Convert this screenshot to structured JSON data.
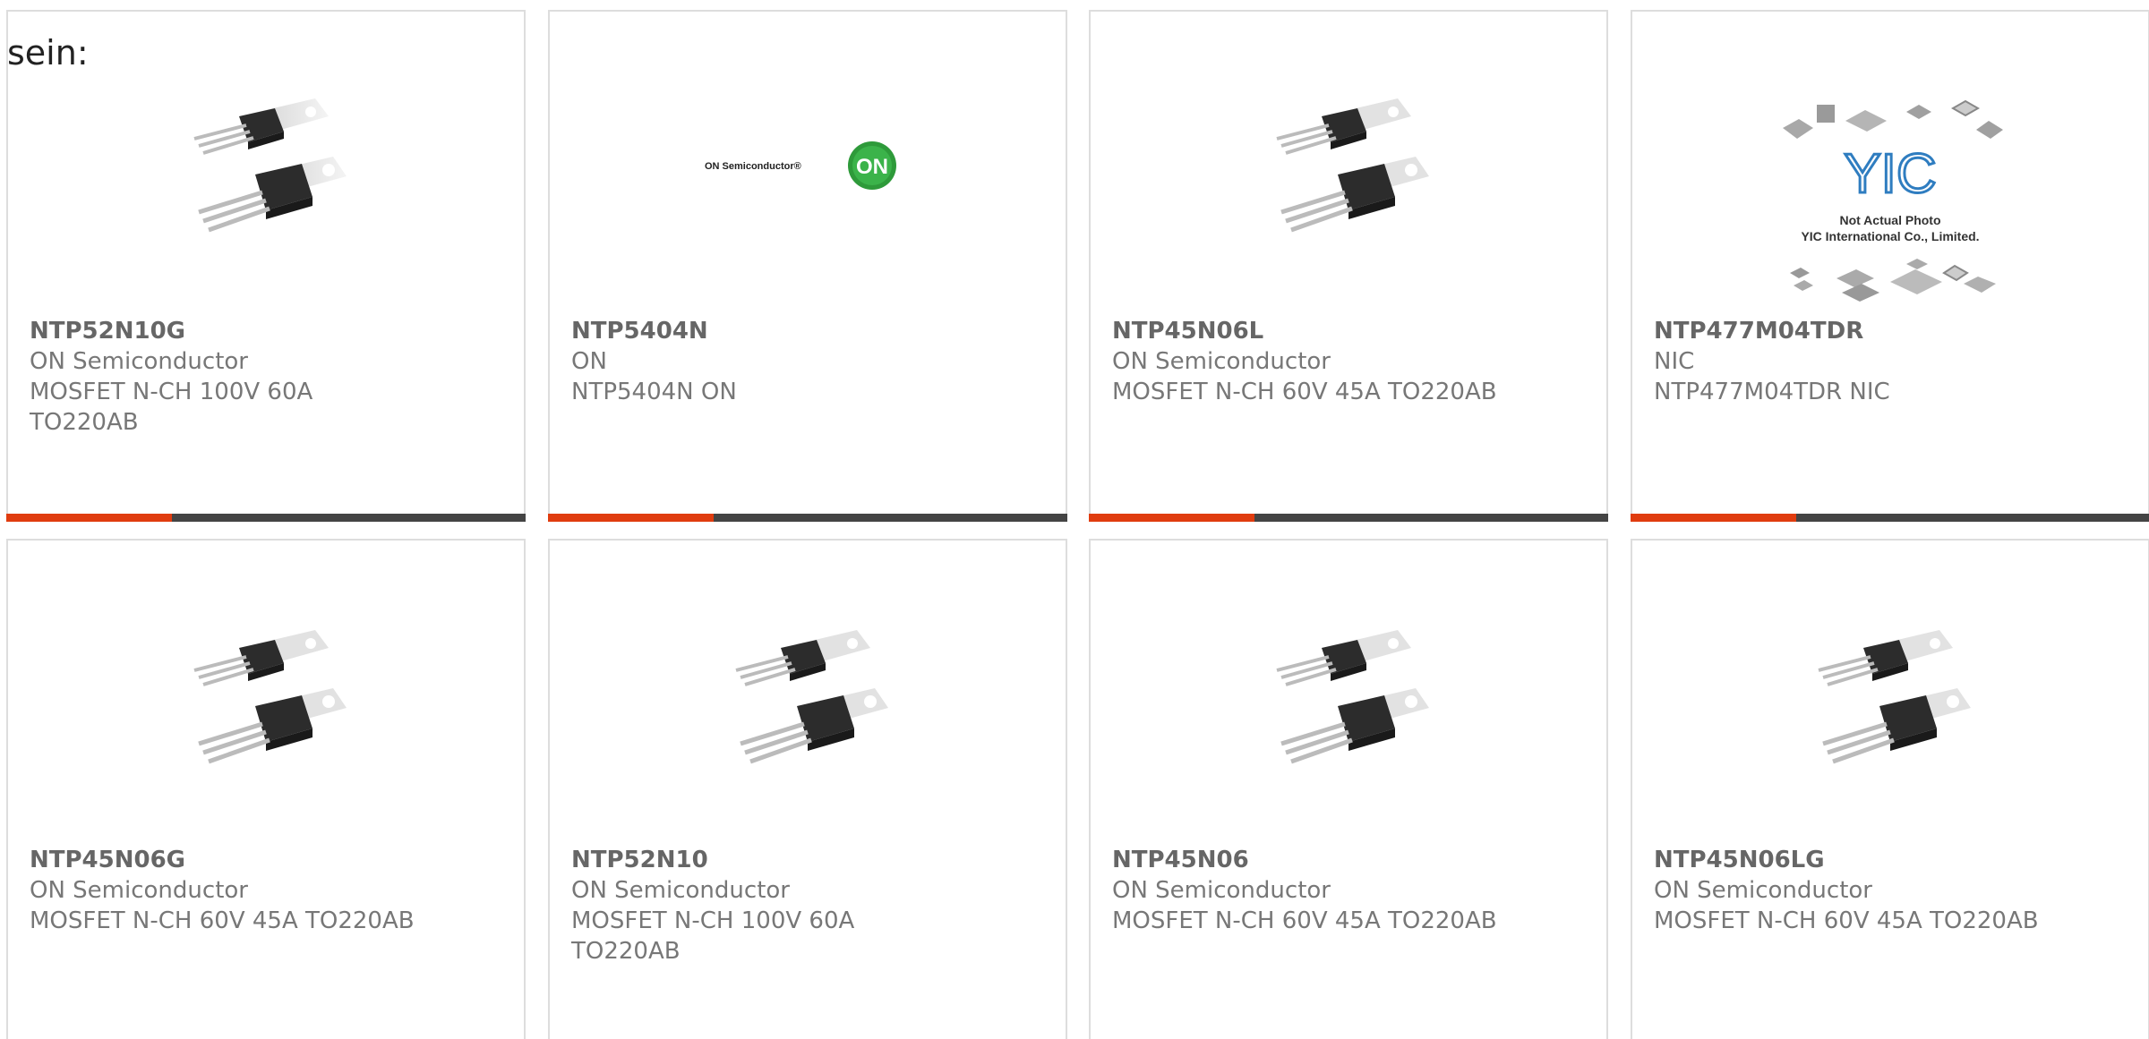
{
  "fragment_text": "sein:",
  "colors": {
    "accent": "#e03c0f",
    "bar": "#444444",
    "border": "#dddddd",
    "text": "#777777",
    "on_green": "#2e9a3a",
    "yic_blue": "#2f7dc0"
  },
  "products": [
    {
      "part": "NTP52N10G",
      "manufacturer": "ON Semiconductor",
      "description": "MOSFET N-CH 100V 60A TO220AB",
      "image": "to220-transistor-icon"
    },
    {
      "part": "NTP5404N",
      "manufacturer": "ON",
      "description": "NTP5404N ON",
      "image": "on-semiconductor-logo"
    },
    {
      "part": "NTP45N06L",
      "manufacturer": "ON Semiconductor",
      "description": "MOSFET N-CH 60V 45A TO220AB",
      "image": "to220-transistor-icon"
    },
    {
      "part": "NTP477M04TDR",
      "manufacturer": "NIC",
      "description": "NTP477M04TDR NIC",
      "image": "yic-placeholder-image"
    },
    {
      "part": "NTP45N06G",
      "manufacturer": "ON Semiconductor",
      "description": "MOSFET N-CH 60V 45A TO220AB",
      "image": "to220-transistor-icon"
    },
    {
      "part": "NTP52N10",
      "manufacturer": "ON Semiconductor",
      "description": "MOSFET N-CH 100V 60A TO220AB",
      "image": "to220-transistor-icon"
    },
    {
      "part": "NTP45N06",
      "manufacturer": "ON Semiconductor",
      "description": "MOSFET N-CH 60V 45A TO220AB",
      "image": "to220-transistor-icon"
    },
    {
      "part": "NTP45N06LG",
      "manufacturer": "ON Semiconductor",
      "description": "MOSFET N-CH 60V 45A TO220AB",
      "image": "to220-transistor-icon"
    }
  ],
  "logos": {
    "on_semiconductor_text": "ON Semiconductor®",
    "on_badge": "ON",
    "yic_mark": "YIC",
    "yic_caption_line1": "Not Actual Photo",
    "yic_caption_line2": "YIC International Co., Limited."
  }
}
